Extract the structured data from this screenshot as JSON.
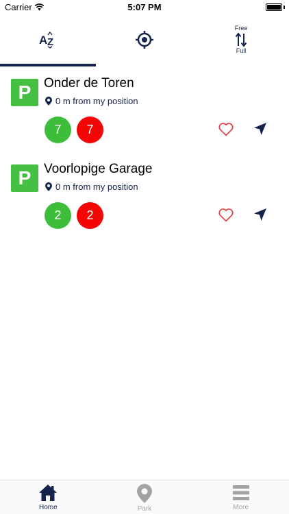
{
  "status_bar": {
    "carrier": "Carrier",
    "time": "5:07 PM"
  },
  "sort_tabs": {
    "az_label": "AZ",
    "free_label": "Free",
    "full_label": "Full",
    "active_tab": "az"
  },
  "parkings": [
    {
      "logo": "P",
      "name": "Onder de Toren",
      "distance": "0 m from my position",
      "free": "7",
      "full": "7"
    },
    {
      "logo": "P",
      "name": "Voorlopige Garage",
      "distance": "0 m from my position",
      "free": "2",
      "full": "2"
    }
  ],
  "tab_bar": {
    "items": [
      {
        "label": "Home",
        "icon": "home-icon",
        "active": true
      },
      {
        "label": "Park",
        "icon": "map-pin-icon",
        "active": false
      },
      {
        "label": "More",
        "icon": "menu-icon",
        "active": false
      }
    ]
  },
  "colors": {
    "primary": "#14244a",
    "free_green": "#3dbd3a",
    "full_red": "#f50505",
    "logo_green": "#46c043",
    "heart": "#e0474c",
    "inactive": "#a3a3a3"
  }
}
